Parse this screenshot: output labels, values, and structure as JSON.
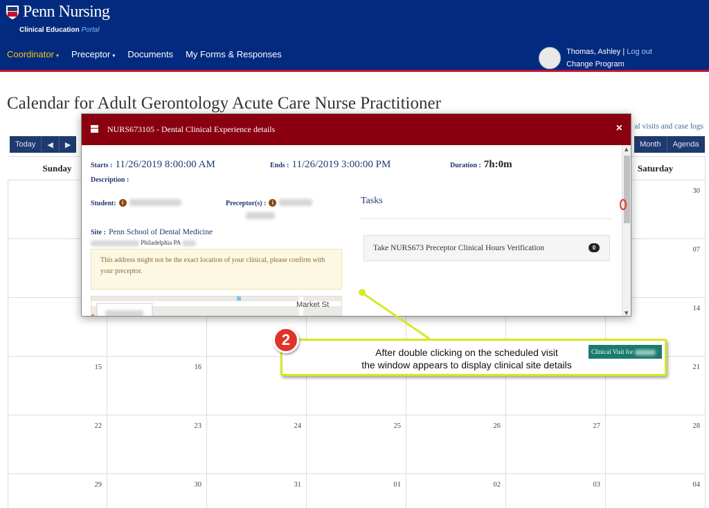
{
  "header": {
    "brand_name": "Penn Nursing",
    "brand_sub": "Clinical Education",
    "brand_sub_suffix": "Portal",
    "nav": [
      {
        "label": "Coordinator",
        "caret": "▾",
        "active": true
      },
      {
        "label": "Preceptor",
        "caret": "▾",
        "active": false
      },
      {
        "label": "Documents",
        "caret": "",
        "active": false
      },
      {
        "label": "My Forms & Responses",
        "caret": "",
        "active": false
      }
    ],
    "user_name": "Thomas, Ashley",
    "separator": "|",
    "logout": "Log out",
    "change_program": "Change Program"
  },
  "page": {
    "title": "Calendar for Adult Gerontology Acute Care Nurse Practitioner",
    "visits_link": "al visits and case logs"
  },
  "calendar": {
    "today": "Today",
    "prev": "◀",
    "next": "▶",
    "month": "Month",
    "agenda": "Agenda",
    "days": [
      "Sunday",
      "",
      "",
      "",
      "",
      "",
      "Saturday"
    ],
    "weeks": [
      [
        "",
        "",
        "",
        "",
        "",
        "",
        "30"
      ],
      [
        "",
        "",
        "",
        "",
        "",
        "",
        "07"
      ],
      [
        "",
        "",
        "",
        "",
        "",
        "",
        "14"
      ],
      [
        "15",
        "16",
        "",
        "",
        "",
        "",
        "21"
      ],
      [
        "22",
        "23",
        "24",
        "25",
        "26",
        "27",
        "28"
      ],
      [
        "29",
        "30",
        "31",
        "01",
        "02",
        "03",
        "04"
      ]
    ]
  },
  "modal": {
    "title": "NURS673105 - Dental Clinical Experience details",
    "close": "×",
    "starts_label": "Starts :",
    "starts_value": "11/26/2019 8:00:00 AM",
    "ends_label": "Ends :",
    "ends_value": "11/26/2019 3:00:00 PM",
    "duration_label": "Duration :",
    "duration_value": "7h:0m",
    "description_label": "Description :",
    "student_label": "Student:",
    "preceptor_label": "Preceptor(s) :",
    "site_label": "Site :",
    "site_value": "Penn School of Dental Medicine",
    "city": "Philadelphia PA",
    "warning": "This address might not be the exact location of your clinical, please confirm with your preceptor.",
    "map_label": "Market St",
    "tasks_title": "Tasks",
    "task_label": "Take NURS673 Preceptor Clinical Hours Verification",
    "task_count": "0"
  },
  "annotation": {
    "step": "2",
    "line1": "After double clicking on the scheduled visit",
    "line2": "the window appears to display clinical site details",
    "chip": "Clinical Visit for"
  },
  "colors": {
    "header": "#022a7f",
    "header_border": "#c8102e",
    "modal_header": "#8a0010",
    "callout_border": "#d6e822",
    "step_badge": "#e0342a",
    "chip": "#1b7a6e"
  }
}
